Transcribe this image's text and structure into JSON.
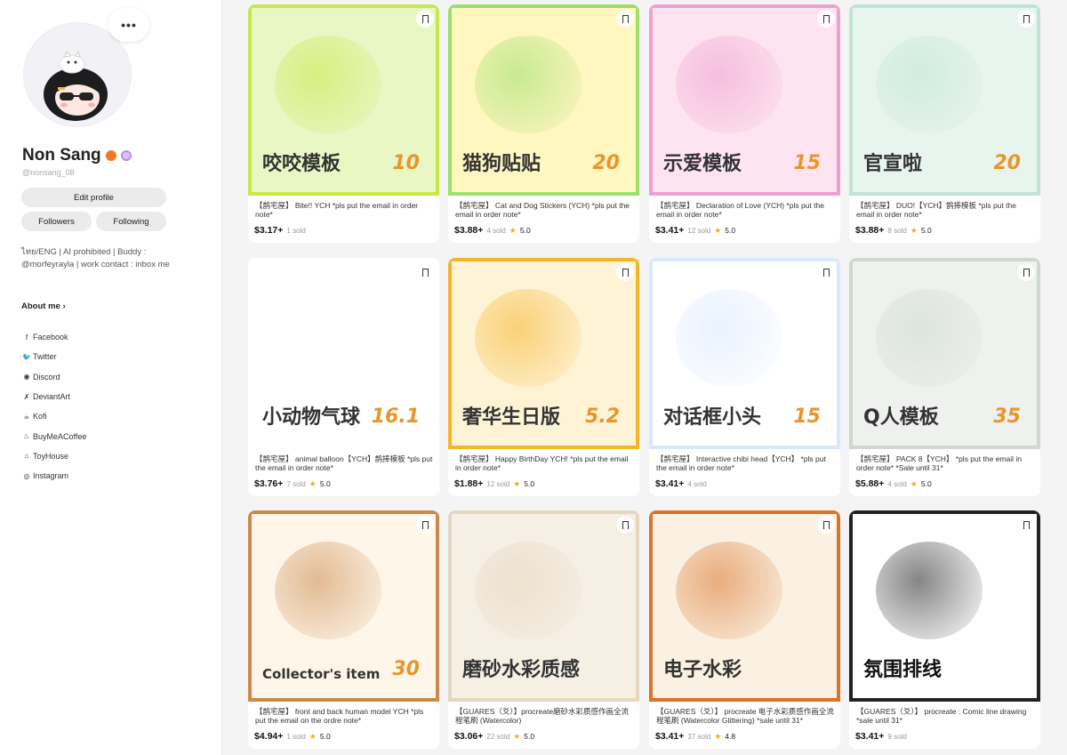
{
  "profile": {
    "name": "Non Sang",
    "handle": "@nonsang_08",
    "more_label": "•••",
    "edit_label": "Edit profile",
    "followers_label": "Followers",
    "following_label": "Following",
    "bio": "ไทย/ENG | AI prohibited | Buddy : @morfeyrayla | work contact : inbox me",
    "about_label": "About me ›",
    "badge_colors": [
      "#f07a2a",
      "#b98ee8"
    ]
  },
  "links": [
    {
      "icon": "facebook-icon",
      "glyph": "f",
      "label": "Facebook"
    },
    {
      "icon": "twitter-icon",
      "glyph": "🐦",
      "label": "Twitter"
    },
    {
      "icon": "discord-icon",
      "glyph": "◉",
      "label": "Discord"
    },
    {
      "icon": "deviantart-icon",
      "glyph": "✗",
      "label": "DeviantArt"
    },
    {
      "icon": "kofi-icon",
      "glyph": "☕",
      "label": "Kofi"
    },
    {
      "icon": "buymeacoffee-icon",
      "glyph": "♨",
      "label": "BuyMeACoffee"
    },
    {
      "icon": "toyhouse-icon",
      "glyph": "⌂",
      "label": "ToyHouse"
    },
    {
      "icon": "instagram-icon",
      "glyph": "◎",
      "label": "Instagram"
    }
  ],
  "products": [
    {
      "title": "【鹊宅屋】 Bite!! YCH *pls put the email in order note*",
      "price": "$3.17+",
      "sold": "1 sold",
      "rating": "",
      "art": "咬咬模板",
      "art_num": "10",
      "bg": "#e9f7c5",
      "frame": "#c8e84a"
    },
    {
      "title": "【鹊宅屋】 Cat and Dog Stickers (YCH) *pls put the email in order note*",
      "price": "$3.88+",
      "sold": "4 sold",
      "rating": "5.0",
      "art": "猫狗贴贴",
      "art_num": "20",
      "bg": "#fff6c0",
      "frame": "#9be06b"
    },
    {
      "title": "【鹊宅屋】 Declaration of Love (YCH) *pls put the email in order note*",
      "price": "$3.41+",
      "sold": "12 sold",
      "rating": "5.0",
      "art": "示爱模板",
      "art_num": "15",
      "bg": "#fde4f0",
      "frame": "#f0a0d0"
    },
    {
      "title": "【鹊宅屋】 DUO!【YCH】鹊捧模板 *pls put the email in order note*",
      "price": "$3.88+",
      "sold": "8 sold",
      "rating": "5.0",
      "art": "官宣啦",
      "art_num": "20",
      "bg": "#e8f5ef",
      "frame": "#bfe3d5"
    },
    {
      "title": "【鹊宅屋】 animal balloon【YCH】鹊捧模板 *pls put the email in order note*",
      "price": "$3.76+",
      "sold": "7 sold",
      "rating": "5.0",
      "art": "小动物气球",
      "art_num": "16.1",
      "bg": "#ffffff",
      "frame": "#ffffff"
    },
    {
      "title": "【鹊宅屋】 Happy BirthDay YCH! *pls put the email in order note*",
      "price": "$1.88+",
      "sold": "12 sold",
      "rating": "5.0",
      "art": "奢华生日版",
      "art_num": "5.2",
      "bg": "#fff3d6",
      "frame": "#f5b52a"
    },
    {
      "title": "【鹊宅屋】 Interactive chibi head【YCH】 *pls put the email in order note*",
      "price": "$3.41+",
      "sold": "4 sold",
      "rating": "",
      "art": "对话框小头",
      "art_num": "15",
      "bg": "#ffffff",
      "frame": "#d8e8ff"
    },
    {
      "title": "【鹊宅屋】 PACK 8【YCH】 *pls put the email in order note* *Sale until 31*",
      "price": "$5.88+",
      "sold": "4 sold",
      "rating": "5.0",
      "art": "Q人模板",
      "art_num": "35",
      "bg": "#eef1ee",
      "frame": "#cfd8cf"
    },
    {
      "title": "【鹊宅屋】 front and back human model YCH *pls put the email on the ordre note*",
      "price": "$4.94+",
      "sold": "1 sold",
      "rating": "5.0",
      "art": "Collector's item",
      "art_num": "30",
      "bg": "#fff6ea",
      "frame": "#c98a4b"
    },
    {
      "title": "【GUARES（爻）】procreate磨砂水彩质感作画全流程笔刷 (Watercolor)",
      "price": "$3.06+",
      "sold": "22 sold",
      "rating": "5.0",
      "art": "磨砂水彩质感",
      "art_num": "",
      "bg": "#f5efe4",
      "frame": "#e7d6bf"
    },
    {
      "title": "【GUARES（爻）】 procreate 电子水彩质感作画全流程笔刷 (Watercolor Glittering) *sale until 31*",
      "price": "$3.41+",
      "sold": "37 sold",
      "rating": "4.8",
      "art": "电子水彩",
      "art_num": "",
      "bg": "#fbf1e2",
      "frame": "#d9742a"
    },
    {
      "title": "【GUARES（爻）】 procreate : Comic line drawing *sale until 31*",
      "price": "$3.41+",
      "sold": "9 sold",
      "rating": "",
      "art": "氛围排线",
      "art_num": "",
      "bg": "#ffffff",
      "frame": "#222222"
    }
  ]
}
